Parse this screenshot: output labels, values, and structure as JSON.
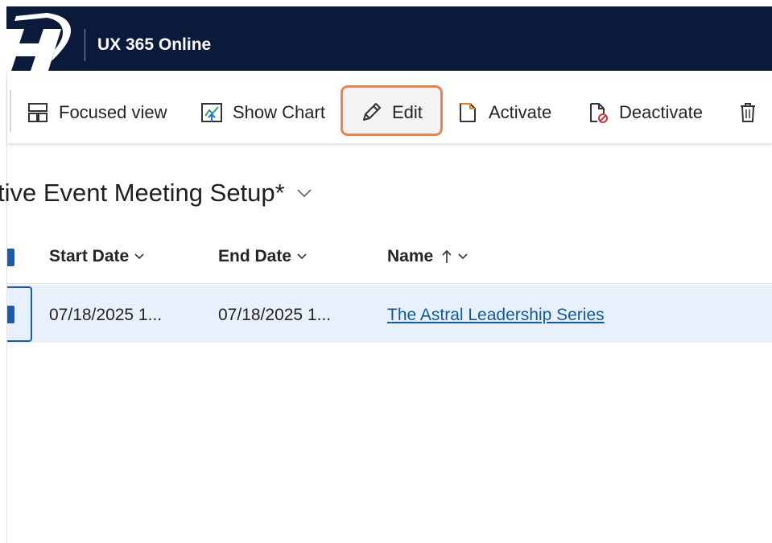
{
  "header": {
    "app_title": "UX 365 Online",
    "logo_icon": "company-logo-h",
    "background": "#0b1a3b"
  },
  "commandbar": {
    "items": [
      {
        "label": "Focused view",
        "icon": "focused-view-icon"
      },
      {
        "label": "Show Chart",
        "icon": "chart-icon"
      },
      {
        "label": "Edit",
        "icon": "pencil-icon",
        "highlighted": true
      },
      {
        "label": "Activate",
        "icon": "activate-document-icon"
      },
      {
        "label": "Deactivate",
        "icon": "deactivate-document-icon"
      },
      {
        "label": "",
        "icon": "trash-icon"
      }
    ],
    "highlight_color": "#e8834f"
  },
  "view": {
    "title": "tive Event Meeting Setup*",
    "title_dropdown_icon": "chevron-down-icon"
  },
  "grid": {
    "columns": [
      {
        "label": "Start Date",
        "icon": "chevron-down-icon"
      },
      {
        "label": "End Date",
        "icon": "chevron-down-icon"
      },
      {
        "label": "Name",
        "sort_icon": "sort-ascending-arrow-icon",
        "icon": "chevron-down-icon"
      }
    ],
    "rows": [
      {
        "selected": true,
        "start_date": "07/18/2025 1...",
        "end_date": "07/18/2025 1...",
        "name": "The Astral Leadership Series"
      }
    ],
    "selection_color": "#1a5aa8",
    "selected_row_bg": "#e8f1fb",
    "link_color": "#0f5a9e"
  }
}
